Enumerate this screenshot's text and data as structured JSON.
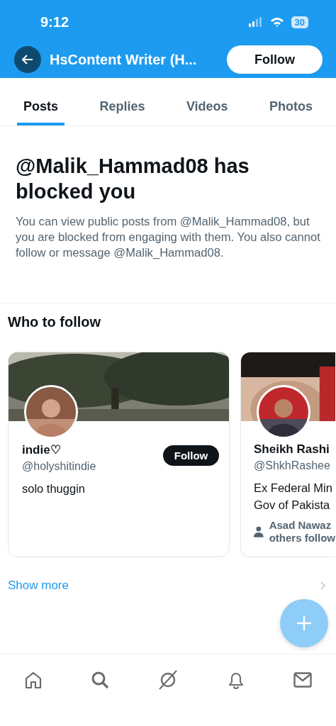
{
  "status_bar": {
    "time": "9:12",
    "battery": "30"
  },
  "header": {
    "title": "HsContent Writer (H...",
    "follow_button": "Follow"
  },
  "tabs": [
    {
      "label": "Posts",
      "selected": true
    },
    {
      "label": "Replies",
      "selected": false
    },
    {
      "label": "Videos",
      "selected": false
    },
    {
      "label": "Photos",
      "selected": false
    }
  ],
  "blocked": {
    "title": "@Malik_Hammad08 has blocked you",
    "body": "You can view public posts from @Malik_Hammad08, but you are blocked from engaging with them. You also cannot follow or message @Malik_Hammad08."
  },
  "who_to_follow": {
    "title": "Who to follow",
    "cards": [
      {
        "name": "indie♡",
        "handle": "@holyshitindie",
        "bio": [
          "solo thuggin"
        ],
        "follow_button": "Follow"
      },
      {
        "name": "Sheikh Rashi",
        "handle": "@ShkhRashee",
        "bio": [
          "Ex Federal Min",
          "Gov of Pakista"
        ],
        "followed_by": [
          "Asad Nawaz",
          "others follow"
        ]
      }
    ],
    "show_more": "Show more"
  }
}
